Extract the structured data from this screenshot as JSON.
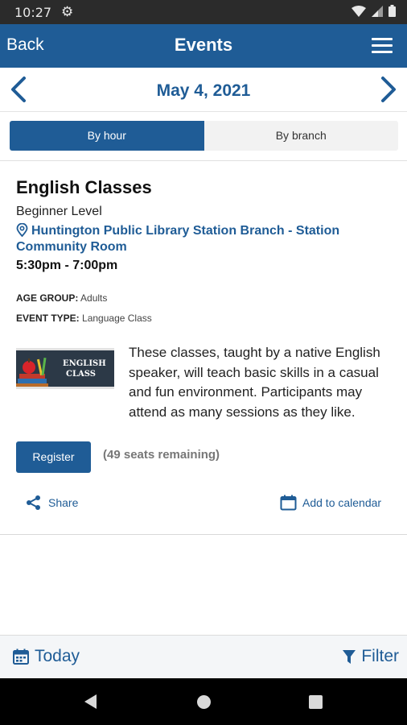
{
  "status": {
    "time": "10:27"
  },
  "appbar": {
    "back_label": "Back",
    "title": "Events"
  },
  "datebar": {
    "date": "May 4, 2021"
  },
  "tabs": [
    {
      "label": "By hour",
      "active": true
    },
    {
      "label": "By branch",
      "active": false
    }
  ],
  "event": {
    "title": "English Classes",
    "subtitle": "Beginner Level",
    "location": "Huntington Public Library Station Branch - Station Community Room",
    "time_range": "5:30pm - 7:00pm",
    "age_group_label": "AGE GROUP:",
    "age_group_value": "Adults",
    "event_type_label": "EVENT TYPE:",
    "event_type_value": "Language Class",
    "thumbnail_text_line1": "ENGLISH",
    "thumbnail_text_line2": "CLASS",
    "description": "These classes, taught by a native English speaker, will teach basic skills in a casual and fun environment. Participants may attend as many sessions as they like.",
    "register_label": "Register",
    "seats": "(49 seats remaining)",
    "share_label": "Share",
    "add_calendar_label": "Add to calendar"
  },
  "bottombar": {
    "today_label": "Today",
    "filter_label": "Filter"
  },
  "colors": {
    "primary": "#1f5c96",
    "status_bar": "#2b2b2b",
    "nav_bar": "#000000"
  },
  "icons": [
    "settings-gear-icon",
    "wifi-icon",
    "signal-icon",
    "battery-icon",
    "menu-icon",
    "chevron-left-icon",
    "chevron-right-icon",
    "location-pin-icon",
    "share-icon",
    "calendar-icon",
    "filter-icon",
    "nav-back-icon",
    "nav-home-icon",
    "nav-recents-icon"
  ]
}
